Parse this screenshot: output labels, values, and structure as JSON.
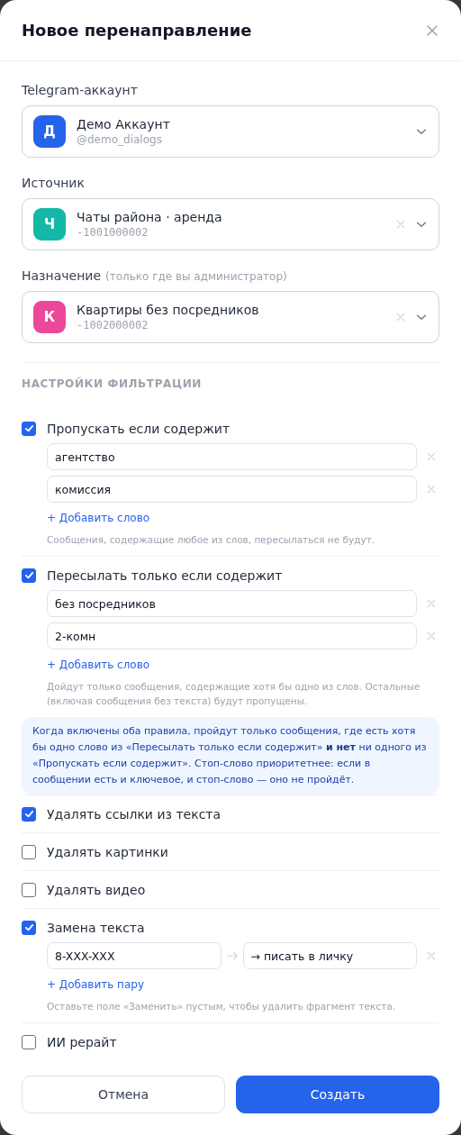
{
  "modal": {
    "title": "Новое перенаправление"
  },
  "selects": [
    {
      "label": "Telegram-аккаунт",
      "avatar": "Д",
      "color": "#2563eb",
      "name": "Демо Аккаунт",
      "sub": "@demo_dialogs",
      "kind": "handle",
      "clearable": false
    },
    {
      "label": "Источник",
      "avatar": "Ч",
      "color": "#14b8a6",
      "name": "Чаты района · аренда",
      "sub": "-1001000002",
      "kind": "id",
      "clearable": true
    },
    {
      "label": "Назначение",
      "note": "(только где вы администратор)",
      "avatar": "К",
      "color": "#ec4899",
      "name": "Квартиры без посредников",
      "sub": "-1002000002",
      "kind": "id",
      "clearable": true
    }
  ],
  "filters": {
    "heading": "НАСТРОЙКИ ФИЛЬТРАЦИИ",
    "options": [
      {
        "kind": "keywords",
        "label": "Пропускать если содержит",
        "checked": true,
        "words": [
          "агентство",
          "комиссия"
        ],
        "add_label": "+ Добавить слово",
        "hint": "Сообщения, содержащие любое из слов, пересылаться не будут."
      },
      {
        "kind": "keywords",
        "label": "Пересылать только если содержит",
        "checked": true,
        "words": [
          "без посредников",
          "2-комн"
        ],
        "add_label": "+ Добавить слово",
        "hint": "Дойдут только сообщения, содержащие хотя бы одно из слов. Остальные (включая сообщения без текста) будут пропущены."
      },
      {
        "kind": "info",
        "text": "Когда включены оба правила, пройдут только сообщения, где есть хотя бы одно слово из «Пересылать только если содержит» **и нет** ни одного из «Пропускать если содержит». Стоп-слово приоритетнее: если в сообщении есть и ключевое, и стоп-слово — оно не пройдёт."
      },
      {
        "kind": "toggle",
        "label": "Удалять ссылки из текста",
        "checked": true
      },
      {
        "kind": "toggle",
        "label": "Удалять картинки",
        "checked": false
      },
      {
        "kind": "toggle",
        "label": "Удалять видео",
        "checked": false
      },
      {
        "kind": "replace",
        "label": "Замена текста",
        "checked": true,
        "pairs": [
          {
            "from": "8-XXX-XXX",
            "to": "→ писать в личку"
          }
        ],
        "add_label": "+ Добавить пару",
        "hint": "Оставьте поле «Заменить» пустым, чтобы удалить фрагмент текста."
      },
      {
        "kind": "toggle",
        "label": "ИИ рерайт",
        "checked": false
      }
    ]
  },
  "buttons": [
    {
      "label": "Отмена",
      "kind": "secondary"
    },
    {
      "label": "Создать",
      "kind": "primary"
    }
  ]
}
